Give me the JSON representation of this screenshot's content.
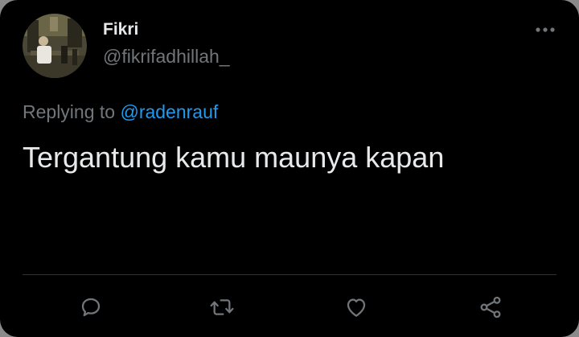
{
  "tweet": {
    "author": {
      "display_name": "Fikri",
      "username": "@fikrifadhillah_"
    },
    "replying_prefix": "Replying to",
    "replying_to": "@radenrauf",
    "text": "Tergantung kamu maunya kapan"
  },
  "actions": [
    {
      "name": "reply",
      "icon": "reply-icon"
    },
    {
      "name": "retweet",
      "icon": "retweet-icon"
    },
    {
      "name": "like",
      "icon": "heart-icon"
    },
    {
      "name": "share",
      "icon": "share-icon"
    }
  ],
  "colors": {
    "background": "#000000",
    "text_primary": "#e7e9ea",
    "text_secondary": "#71767b",
    "accent": "#1d9bf0",
    "divider": "#2f3336"
  }
}
